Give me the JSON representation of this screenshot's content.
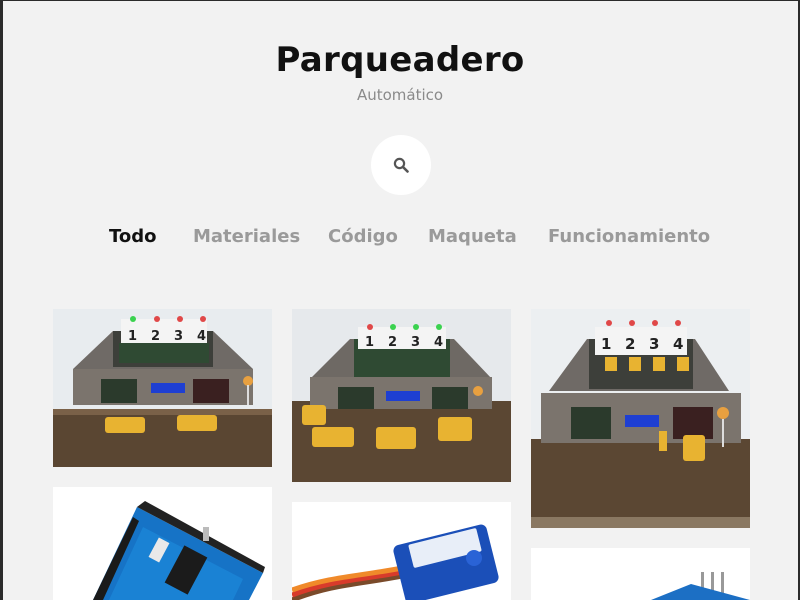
{
  "site": {
    "title": "Parqueadero",
    "subtitle": "Automático"
  },
  "search": {
    "icon": "search-icon"
  },
  "filters": [
    {
      "label": "Todo",
      "active": true
    },
    {
      "label": "Materiales",
      "active": false
    },
    {
      "label": "Código",
      "active": false
    },
    {
      "label": "Maqueta",
      "active": false
    },
    {
      "label": "Funcionamiento",
      "active": false
    }
  ],
  "model_slots": [
    "1",
    "2",
    "3",
    "4"
  ],
  "colors": {
    "background": "#f2f2f2",
    "active_filter": "#111111",
    "inactive_filter": "#9a9a9a"
  }
}
